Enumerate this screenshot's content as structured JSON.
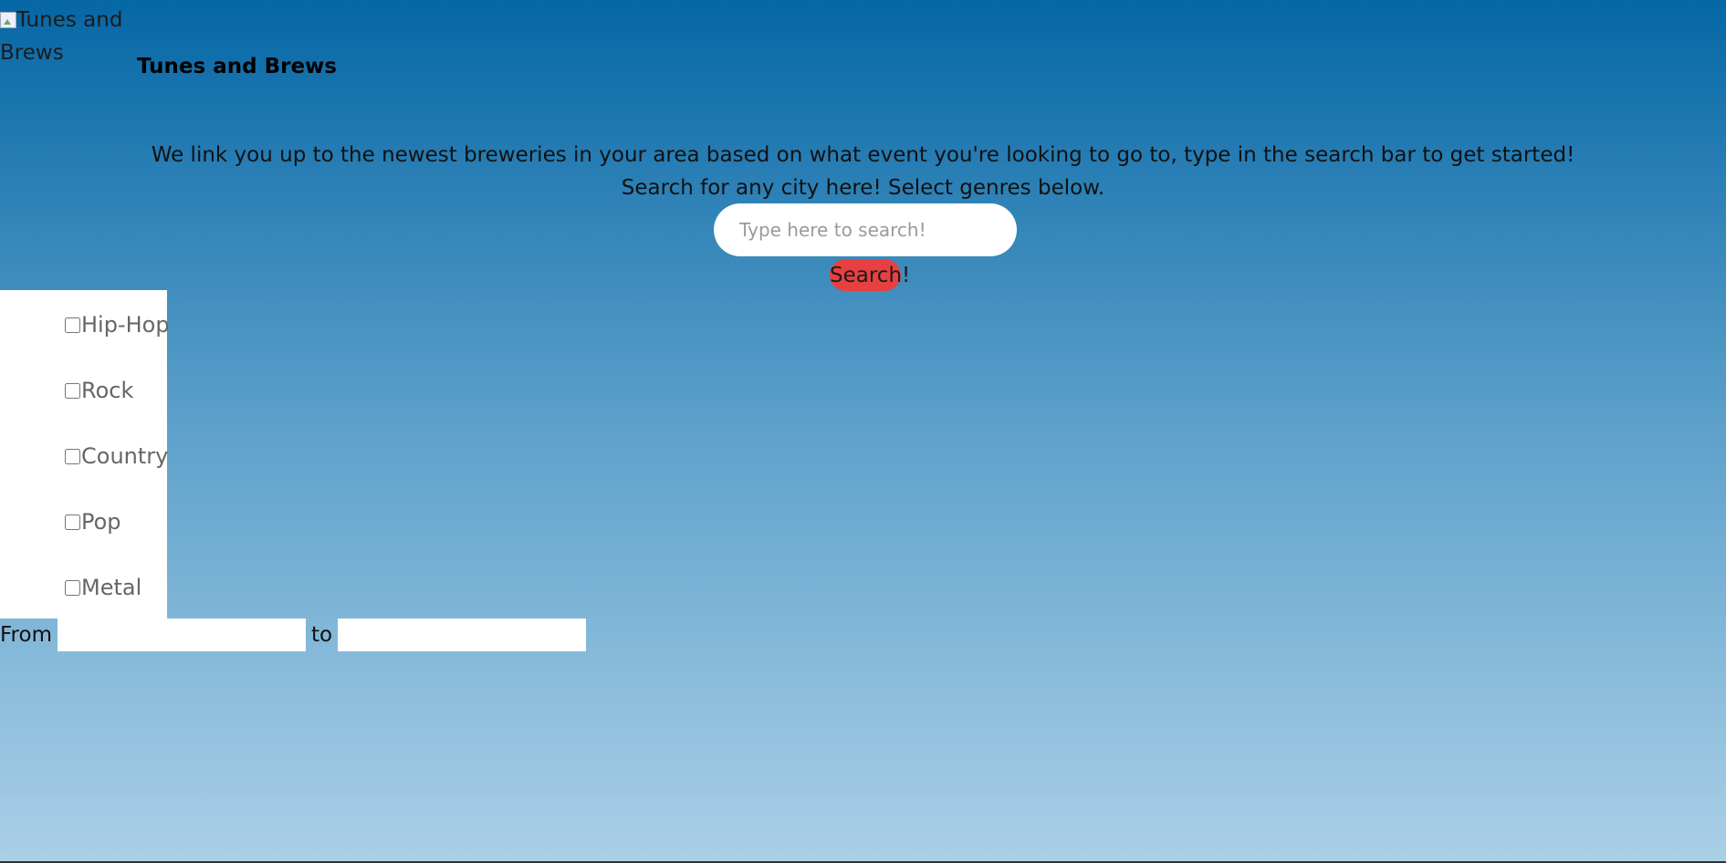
{
  "header": {
    "logo_alt": "Tunes and Brews",
    "title": "Tunes and Brews"
  },
  "intro": {
    "line1": "We link you up to the newest breweries in your area based on what event you're looking to go to, type in the search bar to get started!",
    "line2": "Search for any city here! Select genres below."
  },
  "search": {
    "placeholder": "Type here to search!",
    "value": "",
    "button_label": "Search!"
  },
  "genres": [
    {
      "label": "Hip-Hop",
      "checked": false
    },
    {
      "label": "Rock",
      "checked": false
    },
    {
      "label": "Country",
      "checked": false
    },
    {
      "label": "Pop",
      "checked": false
    },
    {
      "label": "Metal",
      "checked": false
    }
  ],
  "date_range": {
    "from_label": "From",
    "to_label": "to",
    "from_value": "",
    "to_value": ""
  },
  "colors": {
    "gradient_top": "#0567a5",
    "gradient_bottom": "#abd0e7",
    "search_button": "#e84040"
  }
}
